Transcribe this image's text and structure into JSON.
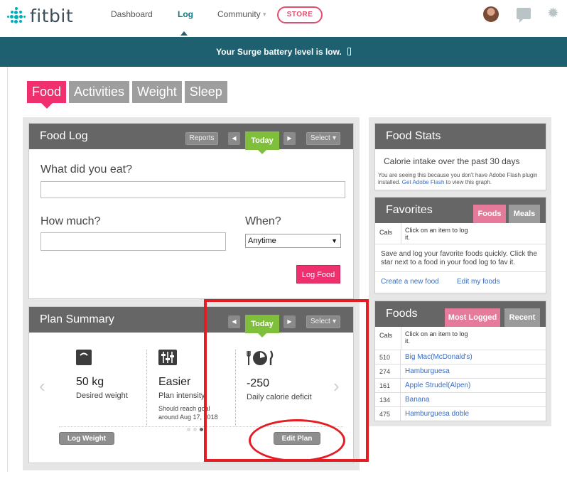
{
  "brand": {
    "name": "fitbit",
    "color": "#00B0B9",
    "accent": "#ef2f6e"
  },
  "nav": {
    "dashboard": "Dashboard",
    "log": "Log",
    "community": "Community",
    "community_caret": "▾",
    "store": "STORE"
  },
  "banner": {
    "text": "Your Surge battery level is low."
  },
  "tabs": [
    "Food",
    "Activities",
    "Weight",
    "Sleep"
  ],
  "food_log": {
    "title": "Food Log",
    "reports": "Reports",
    "prev": "◀",
    "today": "Today",
    "next": "▶",
    "select": "Select",
    "select_caret": "▾",
    "what_label": "What did you eat?",
    "how_label": "How much?",
    "when_label": "When?",
    "when_value": "Anytime",
    "when_caret": "▼",
    "submit": "Log Food"
  },
  "plan_summary": {
    "title": "Plan Summary",
    "prev": "◀",
    "today": "Today",
    "next": "▶",
    "select": "Select",
    "select_caret": "▾",
    "carousel_prev": "‹",
    "carousel_next": "›",
    "metrics": [
      {
        "value": "50 kg",
        "label": "Desired weight",
        "note": ""
      },
      {
        "value": "Easier",
        "label": "Plan intensity",
        "note": "Should reach goal around Aug 17, 2018"
      },
      {
        "value": "-250",
        "label": "Daily calorie deficit",
        "note": ""
      }
    ],
    "log_weight": "Log Weight",
    "edit_plan": "Edit Plan",
    "page_dots": 3,
    "active_dot": 3
  },
  "food_stats": {
    "title": "Food Stats",
    "subtitle": "Calorie intake over the past 30 days",
    "flash_note_pre": "You are seeing this because you don't have Adobe Flash plugin installed. ",
    "flash_link": "Get Adobe Flash",
    "flash_note_post": " to view this graph."
  },
  "favorites": {
    "title": "Favorites",
    "tab_foods": "Foods",
    "tab_meals": "Meals",
    "col_cals": "Cals",
    "col_hint": "Click on an item to log it.",
    "empty_text": "Save and log your favorite foods quickly. Click the star next to a food in your food log to fav it.",
    "create_link": "Create a new food",
    "edit_link": "Edit my foods"
  },
  "foods": {
    "title": "Foods",
    "tab_most": "Most Logged",
    "tab_recent": "Recent",
    "col_cals": "Cals",
    "col_hint": "Click on an item to log it.",
    "rows": [
      {
        "cals": "510",
        "name": "Big Mac(McDonald's)"
      },
      {
        "cals": "274",
        "name": "Hamburguesa"
      },
      {
        "cals": "161",
        "name": "Apple Strudel(Alpen)"
      },
      {
        "cals": "134",
        "name": "Banana"
      },
      {
        "cals": "475",
        "name": "Hamburguesa doble"
      }
    ]
  }
}
